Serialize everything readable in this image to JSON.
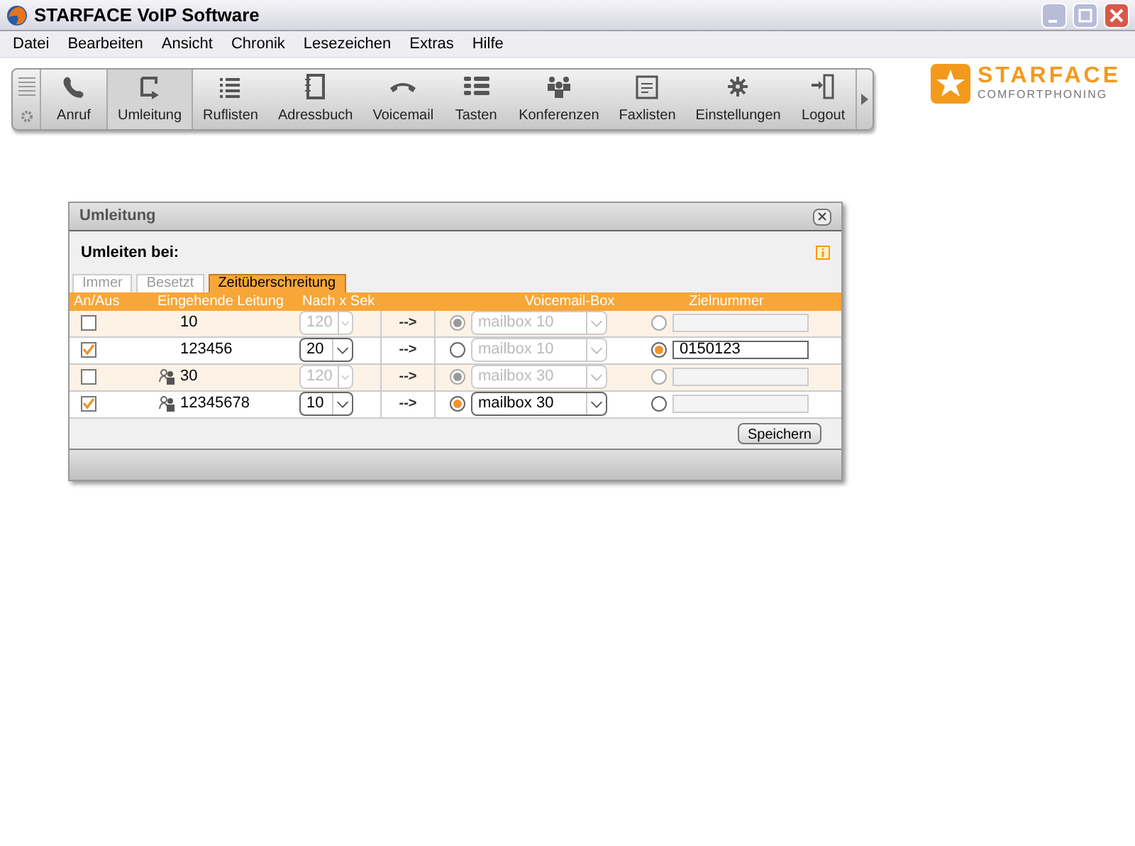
{
  "window": {
    "title": "STARFACE VoIP Software"
  },
  "menu": [
    "Datei",
    "Bearbeiten",
    "Ansicht",
    "Chronik",
    "Lesezeichen",
    "Extras",
    "Hilfe"
  ],
  "toolbar": [
    {
      "label": "Anruf",
      "selected": false
    },
    {
      "label": "Umleitung",
      "selected": true
    },
    {
      "label": "Ruflisten",
      "selected": false
    },
    {
      "label": "Adressbuch",
      "selected": false
    },
    {
      "label": "Voicemail",
      "selected": false
    },
    {
      "label": "Tasten",
      "selected": false
    },
    {
      "label": "Konferenzen",
      "selected": false
    },
    {
      "label": "Faxlisten",
      "selected": false
    },
    {
      "label": "Einstellungen",
      "selected": false
    },
    {
      "label": "Logout",
      "selected": false
    }
  ],
  "logo": {
    "name": "STARFACE",
    "tagline": "COMFORTPHONING"
  },
  "dialog": {
    "title": "Umleitung",
    "heading": "Umleiten bei:",
    "tabs": [
      {
        "label": "Immer",
        "selected": false
      },
      {
        "label": "Besetzt",
        "selected": false
      },
      {
        "label": "Zeitüberschreitung",
        "selected": true
      }
    ],
    "columns": [
      "An/Aus",
      "Eingehende Leitung",
      "Nach x Sek",
      "Voicemail-Box",
      "Zielnummer"
    ],
    "arrow": "-->",
    "rows": [
      {
        "checked": false,
        "group": false,
        "line": "10",
        "seconds": "120",
        "voicemail_selected": true,
        "mailbox": "mailbox 10",
        "target_selected": false,
        "target": ""
      },
      {
        "checked": true,
        "group": false,
        "line": "123456",
        "seconds": "20",
        "voicemail_selected": false,
        "mailbox": "mailbox 10",
        "target_selected": true,
        "target": "0150123"
      },
      {
        "checked": false,
        "group": true,
        "line": "30",
        "seconds": "120",
        "voicemail_selected": true,
        "mailbox": "mailbox 30",
        "target_selected": false,
        "target": ""
      },
      {
        "checked": true,
        "group": true,
        "line": "12345678",
        "seconds": "10",
        "voicemail_selected": true,
        "mailbox": "mailbox 30",
        "target_selected": false,
        "target": ""
      }
    ],
    "save": "Speichern"
  }
}
